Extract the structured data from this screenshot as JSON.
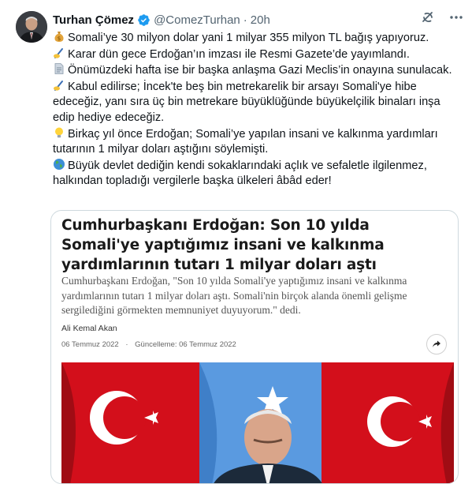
{
  "tweet": {
    "author_name": "Turhan Çömez",
    "handle": "@ComezTurhan",
    "separator": "·",
    "time": "20h",
    "icons": [
      "verified-badge-icon",
      "grok-icon",
      "more-icon"
    ],
    "lines": [
      {
        "emoji": "money-bag",
        "text": "Somali’ye 30 milyon dolar yani 1 milyar 355 milyon TL bağış yapıyoruz."
      },
      {
        "emoji": "writing-hand",
        "text": "Karar dün gece Erdoğan’ın imzası ile Resmi Gazete’de yayımlandı."
      },
      {
        "emoji": "page",
        "text": "Önümüzdeki hafta ise bir başka anlaşma Gazi Meclis’in onayına sunulacak."
      },
      {
        "emoji": "writing-hand",
        "text": "Kabul edilirse; İncek'te beş bin metrekarelik bir arsayı Somali'ye hibe edeceğiz, yanı sıra üç bin metrekare büyüklüğünde büyükelçilik binaları inşa edip hediye edeceğiz."
      },
      {
        "emoji": "light-bulb",
        "text": "Birkaç yıl önce Erdoğan; Somali’ye yapılan insani ve kalkınma yardımları tutarının 1 milyar doları aştığını söylemişti."
      },
      {
        "emoji": "globe",
        "text": "Büyük devlet dediğin kendi sokaklarındaki açlık ve sefaletle ilgilenmez, halkından topladığı vergilerle başka ülkeleri âbâd eder!"
      }
    ]
  },
  "card": {
    "headline": "Cumhurbaşkanı Erdoğan: Son 10 yılda Somali'ye yaptığımız insani ve kalkınma yardımlarının tutarı 1 milyar doları aştı",
    "summary": "Cumhurbaşkanı Erdoğan, \"Son 10 yılda Somali'ye yaptığımız insani ve kalkınma yardımlarının tutarı 1 milyar doları aştı. Somali'nin birçok alanda önemli gelişme sergilediğini görmekten memnuniyet duyuyorum.\" dedi.",
    "author": "Ali Kemal Akan",
    "date": "06 Temmuz 2022",
    "updated_label": "Güncelleme: 06 Temmuz 2022",
    "share_icon": "share-arrow-icon",
    "image": "photo-of-speaker-in-front-of-flags"
  },
  "colors": {
    "text": "#0f1419",
    "muted": "#536471",
    "verified_blue": "#1d9bf0",
    "flag_red": "#e30a17",
    "somali_blue": "#4189dd"
  }
}
